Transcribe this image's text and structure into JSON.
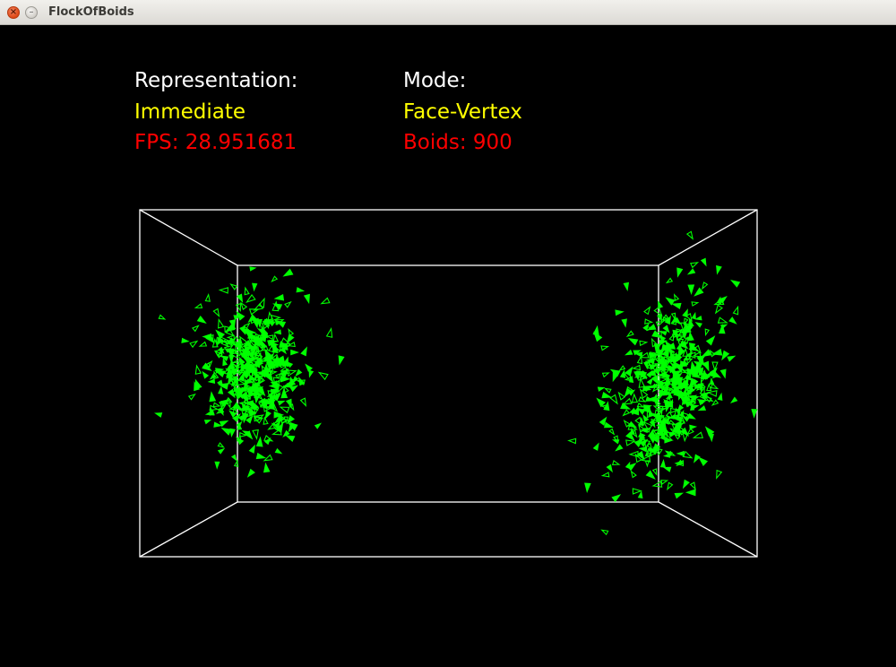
{
  "window": {
    "title": "FlockOfBoids",
    "close_glyph": "×",
    "minimize_glyph": "–"
  },
  "hud": {
    "representation_label": "Representation:",
    "representation_value": "Immediate",
    "fps_text": "FPS: 28.951681",
    "mode_label": "Mode:",
    "mode_value": "Face-Vertex",
    "boids_text": "Boids: 900"
  },
  "colors": {
    "label": "#ffffff",
    "value": "#ffff00",
    "stat": "#ff0000",
    "boid": "#00ff00",
    "box": "#ffffff"
  },
  "icons": [
    "close-icon",
    "minimize-icon"
  ]
}
